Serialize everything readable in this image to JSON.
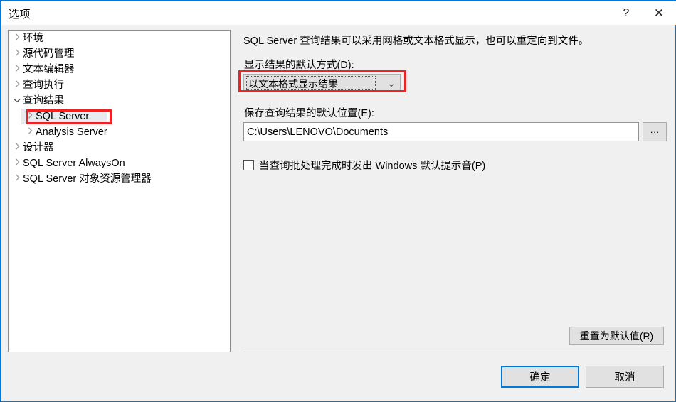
{
  "window": {
    "title": "选项",
    "help_label": "?",
    "close_label": "✕"
  },
  "tree": {
    "items": [
      {
        "label": "环境",
        "level": 0,
        "expanded": false,
        "selected": false
      },
      {
        "label": "源代码管理",
        "level": 0,
        "expanded": false,
        "selected": false
      },
      {
        "label": "文本编辑器",
        "level": 0,
        "expanded": false,
        "selected": false
      },
      {
        "label": "查询执行",
        "level": 0,
        "expanded": false,
        "selected": false
      },
      {
        "label": "查询结果",
        "level": 0,
        "expanded": true,
        "selected": false
      },
      {
        "label": "SQL Server",
        "level": 1,
        "expanded": false,
        "selected": true
      },
      {
        "label": "Analysis Server",
        "level": 1,
        "expanded": false,
        "selected": false
      },
      {
        "label": "设计器",
        "level": 0,
        "expanded": false,
        "selected": false
      },
      {
        "label": "SQL Server AlwaysOn",
        "level": 0,
        "expanded": false,
        "selected": false
      },
      {
        "label": "SQL Server 对象资源管理器",
        "level": 0,
        "expanded": false,
        "selected": false
      }
    ]
  },
  "content": {
    "description": "SQL Server 查询结果可以采用网格或文本格式显示，也可以重定向到文件。",
    "display_label": "显示结果的默认方式(D):",
    "display_value": "以文本格式显示结果",
    "display_arrow": "⌄",
    "location_label": "保存查询结果的默认位置(E):",
    "location_value": "C:\\Users\\LENOVO\\Documents",
    "location_placeholder": "",
    "browse_label": "···",
    "sound_label": "当查询批处理完成时发出 Windows 默认提示音(P)",
    "sound_checked": false,
    "reset_label": "重置为默认值(R)"
  },
  "footer": {
    "ok_label": "确定",
    "cancel_label": "取消"
  },
  "annotations": {
    "accent_color": "#ee2222",
    "focus_color": "#0078d7"
  }
}
